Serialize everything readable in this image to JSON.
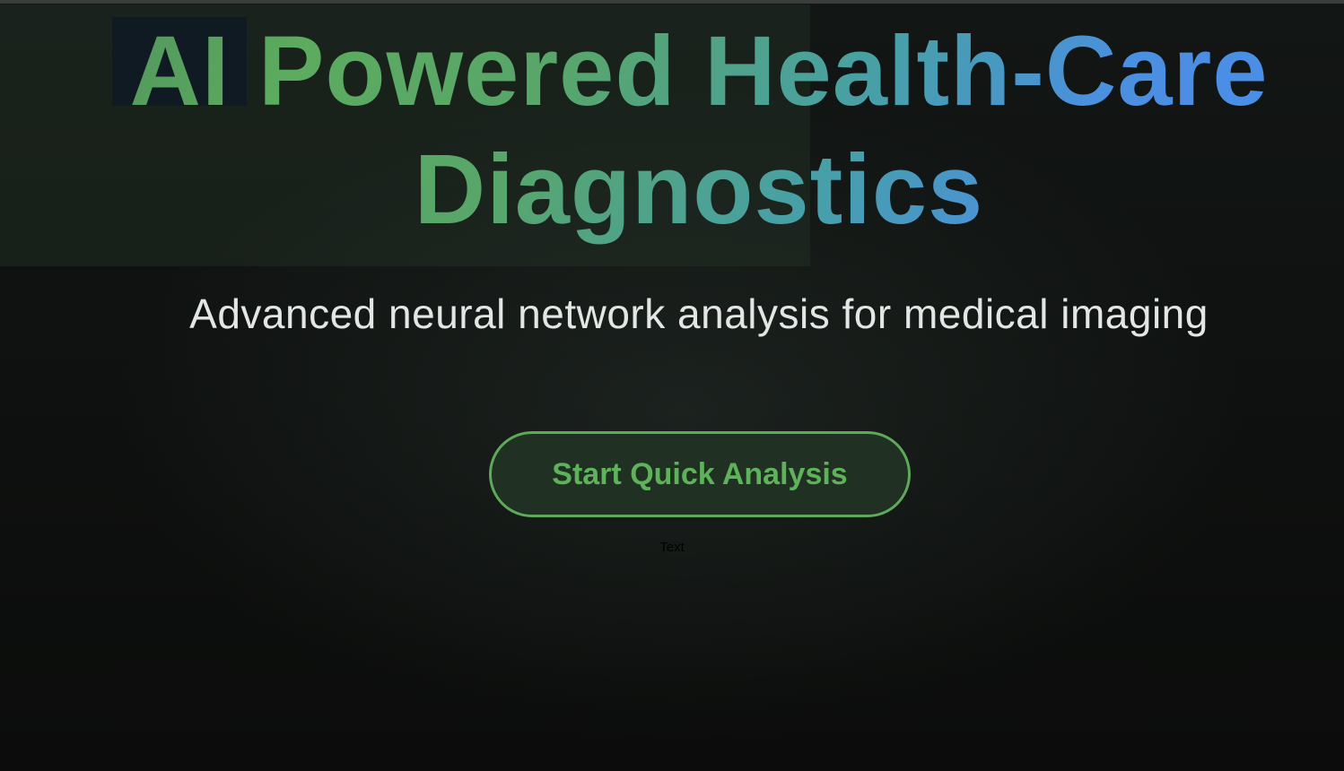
{
  "hero": {
    "title_word_1": "AI",
    "title_rest_line_1": "Powered Health-Care",
    "title_line_2": "Diagnostics",
    "subtitle": "Advanced neural network analysis for medical imaging"
  },
  "cta": {
    "label": "Start Quick Analysis"
  },
  "placeholder_text": "Text",
  "colors": {
    "background": "#0c0e0d",
    "title_gradient_start": "#5cab5f",
    "title_gradient_end": "#4a8df0",
    "button_border": "#5ea95a",
    "button_text": "#5eb25a",
    "subtitle": "#e3e6e4"
  }
}
